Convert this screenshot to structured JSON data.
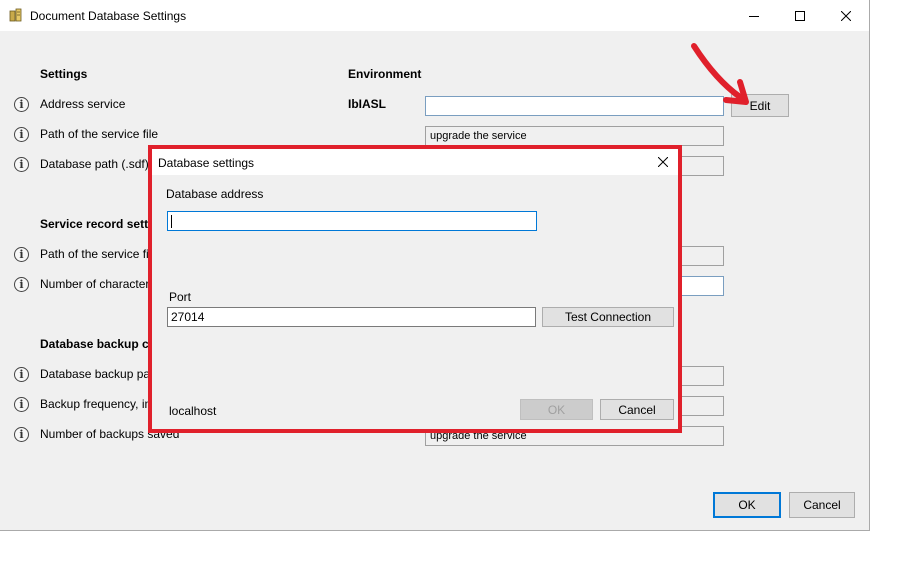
{
  "window": {
    "title": "Document Database Settings"
  },
  "sections": {
    "settings": "Settings",
    "environment": "Environment",
    "service_record": "Service record setti",
    "backup": "Database backup c"
  },
  "env_value_label": "IbIASL",
  "rows": [
    {
      "label": "Address service",
      "value": ""
    },
    {
      "label": "Path of the service file",
      "value": "upgrade the service"
    },
    {
      "label": "Database path (.sdf)",
      "value": ""
    },
    {
      "label": "Path of the service file",
      "value": ""
    },
    {
      "label": "Number of characters",
      "value": ""
    },
    {
      "label": "Database backup path",
      "value": ""
    },
    {
      "label": "Backup frequency, in d",
      "value": ""
    },
    {
      "label": "Number of backups saved",
      "value": "upgrade the service"
    }
  ],
  "buttons": {
    "edit": "Edit",
    "ok": "OK",
    "cancel": "Cancel"
  },
  "dialog": {
    "title": "Database settings",
    "address_label": "Database address",
    "address_value": "",
    "port_label": "Port",
    "port_value": "27014",
    "test_connection": "Test Connection",
    "host": "localhost",
    "ok": "OK",
    "cancel": "Cancel"
  },
  "colors": {
    "highlight": "#e0202b",
    "accent": "#0078d7"
  }
}
